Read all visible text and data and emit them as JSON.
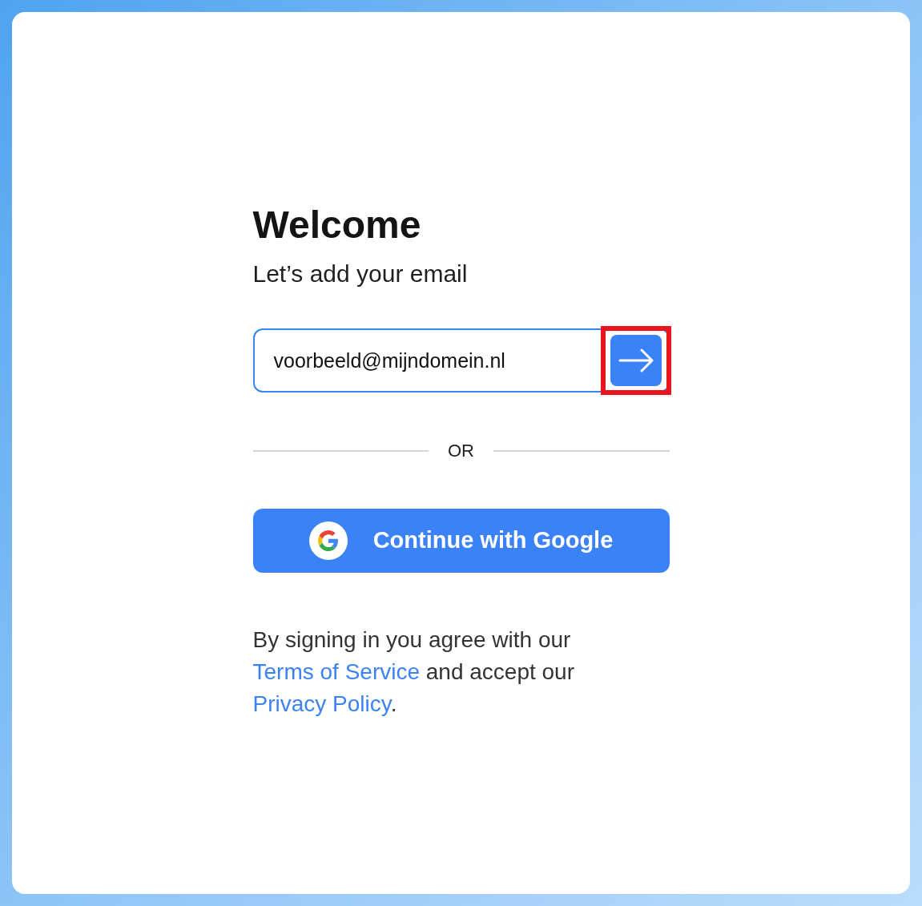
{
  "heading": "Welcome",
  "subheading": "Let’s add your email",
  "email_field": {
    "value": "voorbeeld@mijndomein.nl",
    "focused": true
  },
  "submit_button": {
    "highlighted": true
  },
  "divider_label": "OR",
  "google_button": {
    "label": "Continue with Google"
  },
  "legal": [
    {
      "kind": "text",
      "text": "By signing in you agree with our "
    },
    {
      "kind": "link",
      "text": "Terms of Service"
    },
    {
      "kind": "text",
      "text": " and accept our "
    },
    {
      "kind": "link",
      "text": "Privacy Policy"
    },
    {
      "kind": "text",
      "text": "."
    }
  ]
}
